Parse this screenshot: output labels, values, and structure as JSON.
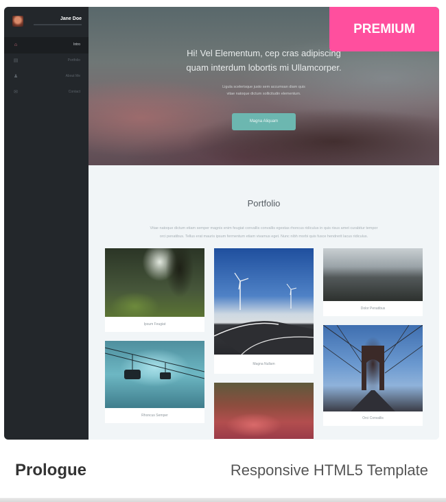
{
  "sidebar": {
    "user_name": "Jane Doe",
    "nav": [
      {
        "icon": "home-icon",
        "glyph": "⌂",
        "label": "Intro",
        "active": true
      },
      {
        "icon": "portfolio-icon",
        "glyph": "▤",
        "label": "Portfolio",
        "active": false
      },
      {
        "icon": "user-icon",
        "glyph": "♟",
        "label": "About Me",
        "active": false
      },
      {
        "icon": "mail-icon",
        "glyph": "✉",
        "label": "Contact",
        "active": false
      }
    ]
  },
  "hero": {
    "title_line1": "Hi! Vel Elementum, cep cras adipiscing",
    "title_line2": "quam interdum lobortis mi Ullamcorper.",
    "sub_line1": "Ligula scelerisque justo sem accumsan diam quis",
    "sub_line2": "vitae natoque dictum sollicitudin elementum.",
    "button": "Magna Aliquam"
  },
  "badge": "PREMIUM",
  "portfolio": {
    "title": "Portfolio",
    "text_line1": "Vitae natoque dictum etiam semper magnis enim feugiat convallis convallis egestas rhoncus ridiculus in quis risus amet curabitur tempor",
    "text_line2": "orci penatibus. Tellus erat mauris ipsum fermentum etiam vivamus eget. Nunc nibh morbi quis fusce hendrerit lacus ridiculus.",
    "items": [
      {
        "image": "forest",
        "caption": "Ipsum Feugiat"
      },
      {
        "image": "wind-turbines-road",
        "caption": "Magna Nullam"
      },
      {
        "image": "misty-hills",
        "caption": "Dolor Penatibus"
      },
      {
        "image": "cable-cars",
        "caption": "Rhoncus Semper"
      },
      {
        "image": "autumn-path",
        "caption": ""
      },
      {
        "image": "bridge",
        "caption": "Orci Convallis"
      }
    ]
  },
  "footer": {
    "name": "Prologue",
    "description": "Responsive HTML5 Template"
  }
}
